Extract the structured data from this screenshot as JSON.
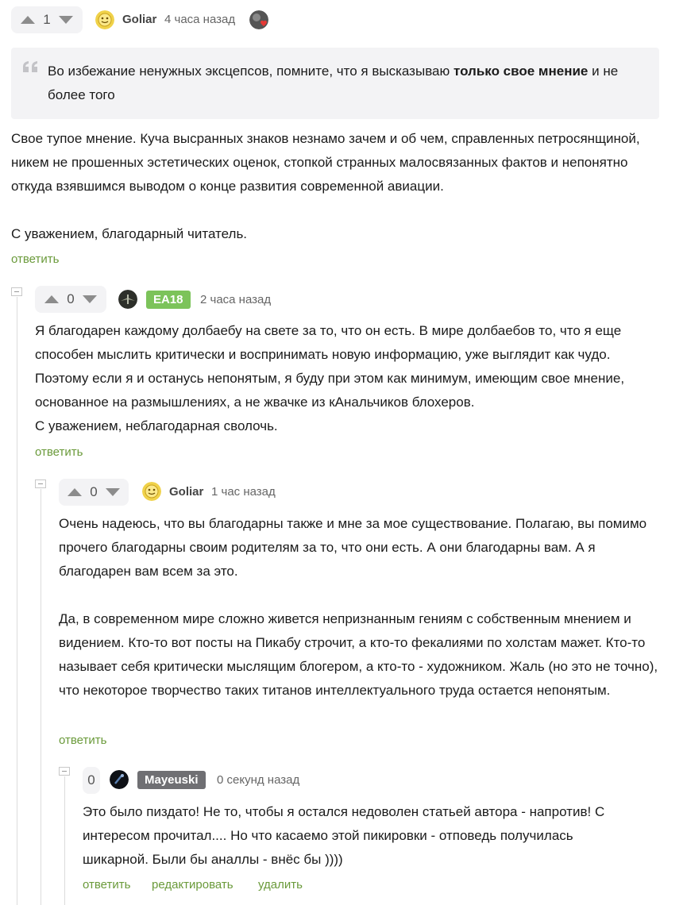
{
  "colors": {
    "accent_green": "#6a9a3a",
    "badge_green": "#7cc35a",
    "badge_gray": "#6f6f73"
  },
  "comment1": {
    "rating": "1",
    "author": "Goliar",
    "time": "4 часа назад",
    "quote_plain_1": "Во избежание ненужных эксцепсов, помните, что я высказываю ",
    "quote_bold": "только свое мнение",
    "quote_plain_2": " и не более того",
    "text_1": "Свое тупое мнение. Куча высранных знаков незнамо зачем и об чем, справленных петросянщиной, никем не прошенных эстетических оценок, стопкой странных малосвязанных фактов и непонятно откуда взявшимся выводом о конце развития современной авиации.",
    "text_2": "С уважением, благодарный читатель.",
    "reply_label": "ответить"
  },
  "comment2": {
    "rating": "0",
    "author": "EA18",
    "time": "2 часа назад",
    "text_1": "Я благодарен каждому долбаебу на свете за то, что он есть. В мире долбаебов то, что я еще способен мыслить критически и воспринимать новую информацию, уже выглядит как чудо. Поэтому если я и останусь непонятым, я буду при этом как минимум, имеющим свое мнение, основанное на размышлениях, а не жвачке из кАнальчиков блохеров.",
    "text_2": "С уважением, неблагодарная сволочь.",
    "reply_label": "ответить"
  },
  "comment3": {
    "rating": "0",
    "author": "Goliar",
    "time": "1 час назад",
    "text_1": "Очень надеюсь, что вы благодарны также и мне за мое существование. Полагаю, вы помимо прочего благодарны своим родителям за то, что они есть. А они благодарны вам. А я благодарен вам всем за это.",
    "text_2": "Да, в современном мире сложно живется непризнанным гениям с собственным мнением и видением. Кто-то вот посты на Пикабу строчит, а кто-то фекалиями по холстам мажет. Кто-то называет себя критически мыслящим блогером, а кто-то - художником. Жаль (но это не точно), что некоторое творчество таких титанов интеллектуального труда остается непонятым.",
    "reply_label": "ответить"
  },
  "comment4": {
    "rating": "0",
    "author": "Mayeuski",
    "time": "0 секунд назад",
    "text_1": "Это было пиздато! Не то, чтобы я остался недоволен статьей автора - напротив! С интересом прочитал.... Но что касаемо этой пикировки - отповедь получилась шикарной. Были бы аналлы - внёс бы ))))",
    "reply_label": "ответить",
    "edit_label": "редактировать",
    "delete_label": "удалить"
  },
  "icons": {
    "upvote": "arrow-up-icon",
    "downvote": "arrow-down-icon",
    "collapse": "collapse-icon",
    "quote": "quote-icon"
  }
}
